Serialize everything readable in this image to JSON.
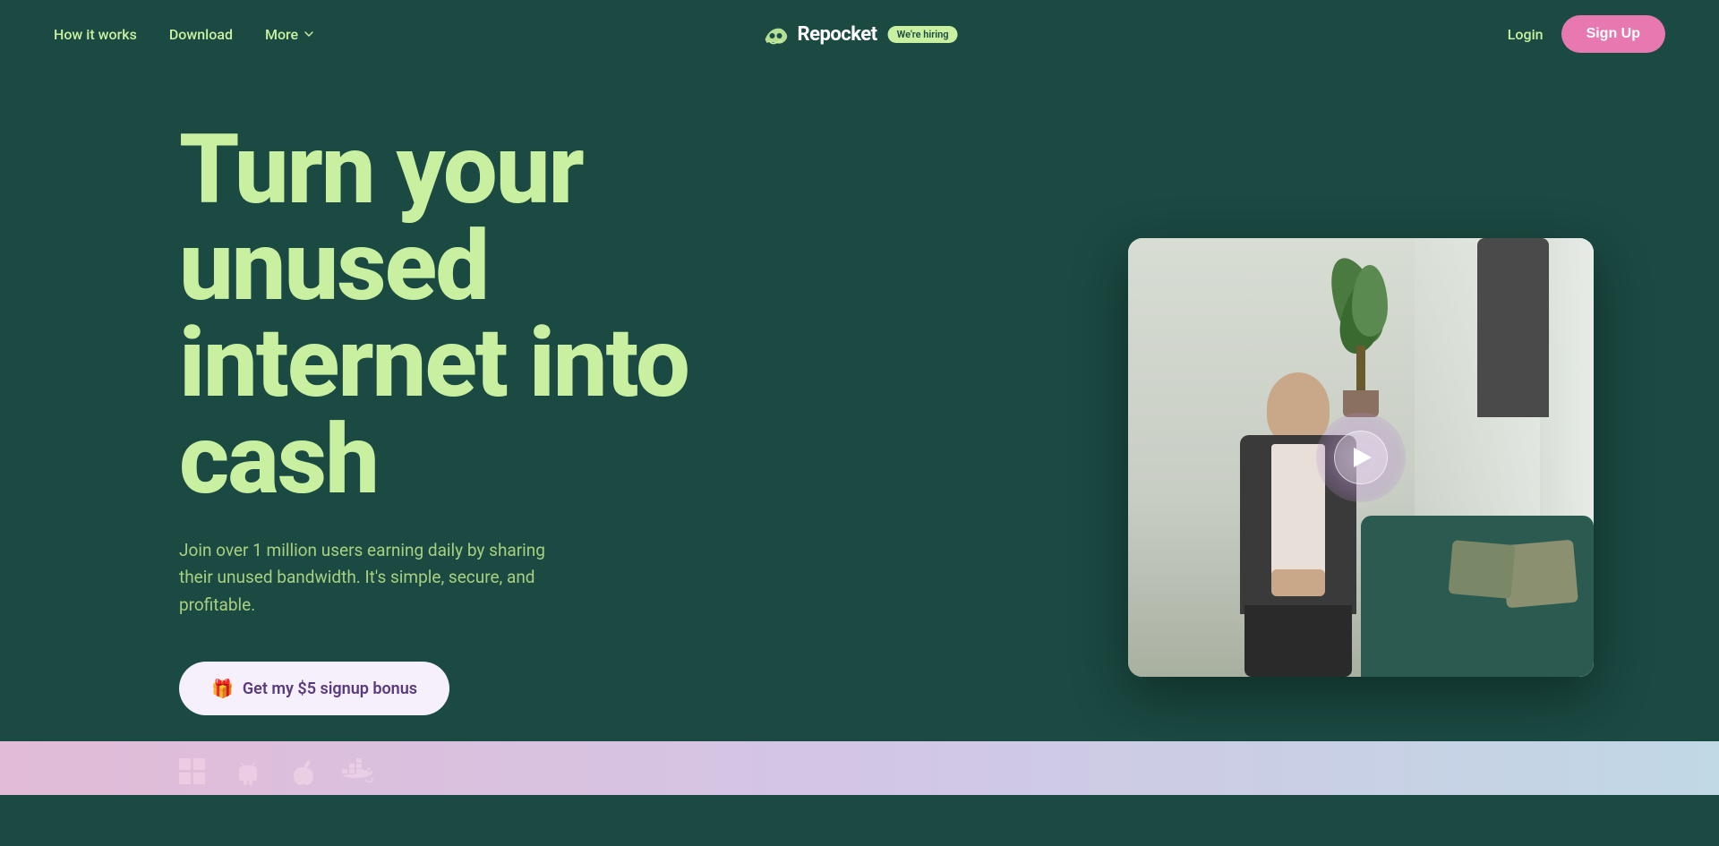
{
  "navbar": {
    "how_it_works": "How it works",
    "download": "Download",
    "more": "More",
    "logo_text": "Repocket",
    "hiring_badge": "We're hiring",
    "login": "Login",
    "signup": "Sign Up"
  },
  "hero": {
    "headline_line1": "Turn your",
    "headline_line2": "unused",
    "headline_line3": "internet into",
    "headline_line4": "cash",
    "subtext": "Join over 1 million users earning daily by sharing their unused bandwidth. It's simple, secure, and profitable.",
    "cta_label": "Get my $5 signup bonus",
    "platforms": [
      "windows",
      "android",
      "apple",
      "docker"
    ]
  },
  "video": {
    "play_label": "Play video"
  },
  "colors": {
    "bg": "#1a4a42",
    "text_green": "#c8f0a0",
    "signup_pink": "#e879b0",
    "cta_bg": "#f5f0fb",
    "cta_text": "#5a3a7e"
  }
}
